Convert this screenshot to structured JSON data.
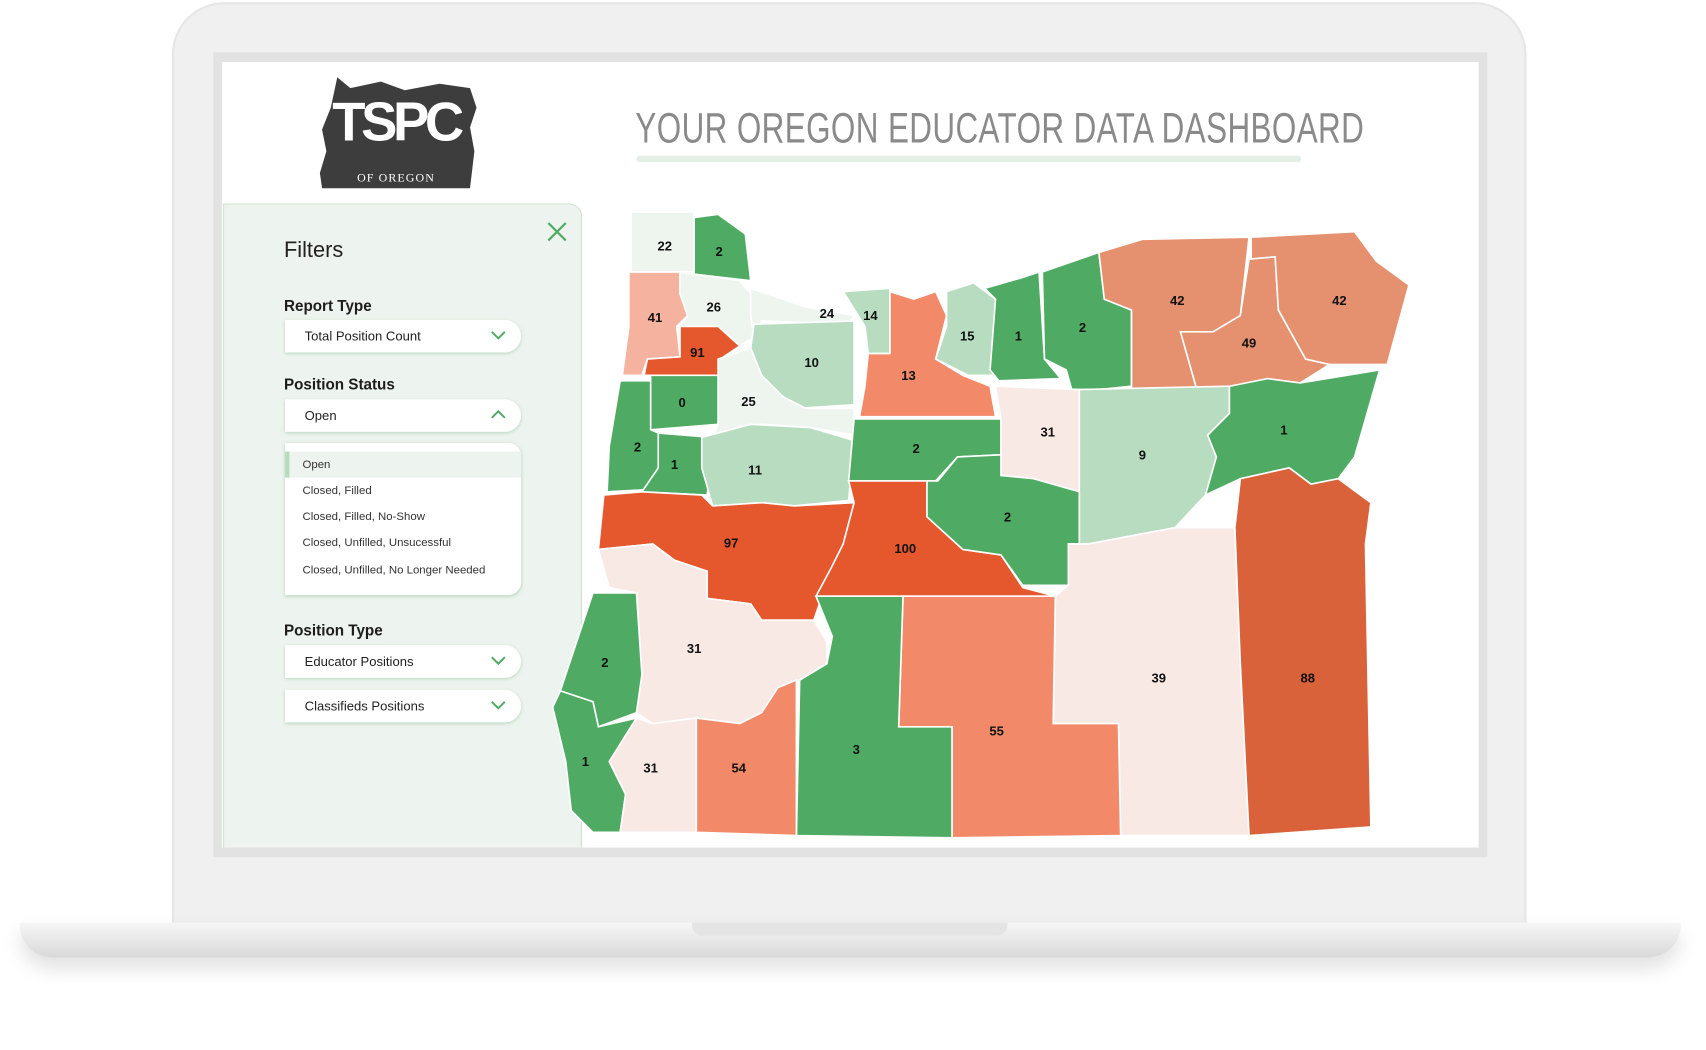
{
  "header": {
    "title": "YOUR OREGON EDUCATOR DATA DASHBOARD",
    "logo_text": "TSPC",
    "logo_subtext": "OF OREGON"
  },
  "filters": {
    "title": "Filters",
    "close_icon": "close-x-icon",
    "report_type": {
      "label": "Report Type",
      "value": "Total Position Count"
    },
    "position_status": {
      "label": "Position Status",
      "value": "Open",
      "expanded": true,
      "options": [
        "Open",
        "Closed, Filled",
        "Closed, Filled, No-Show",
        "Closed, Unfilled, Unsucessful",
        "Closed, Unfilled, No Longer Needed"
      ],
      "selected": "Open"
    },
    "position_type": {
      "label": "Position Type",
      "options": [
        "Educator Positions",
        "Classifieds Positions"
      ]
    }
  },
  "colors": {
    "accent": "#4fab63",
    "panel_bg": "#edf3ee",
    "scale": [
      "#4fab63",
      "#b8dcc0",
      "#eef5ef",
      "#f8e9e5",
      "#f4b29f",
      "#e5906f",
      "#f28a6a",
      "#d9623a",
      "#e5572d"
    ]
  },
  "map": {
    "regions": [
      {
        "value": "22",
        "color": "#eef5ef"
      },
      {
        "value": "2",
        "color": "#4fab63"
      },
      {
        "value": "41",
        "color": "#f4b29f"
      },
      {
        "value": "26",
        "color": "#eef5ef"
      },
      {
        "value": "24",
        "color": "#eef5ef"
      },
      {
        "value": "14",
        "color": "#b8dcc0"
      },
      {
        "value": "91",
        "color": "#e5572d"
      },
      {
        "value": "10",
        "color": "#b8dcc0"
      },
      {
        "value": "13",
        "color": "#f28a6a"
      },
      {
        "value": "15",
        "color": "#b8dcc0"
      },
      {
        "value": "1",
        "color": "#4fab63"
      },
      {
        "value": "2",
        "color": "#4fab63"
      },
      {
        "value": "42",
        "color": "#e5906f"
      },
      {
        "value": "49",
        "color": "#e5906f"
      },
      {
        "value": "42",
        "color": "#e5906f"
      },
      {
        "value": "0",
        "color": "#4fab63"
      },
      {
        "value": "2",
        "color": "#4fab63"
      },
      {
        "value": "25",
        "color": "#eef5ef"
      },
      {
        "value": "1",
        "color": "#4fab63"
      },
      {
        "value": "11",
        "color": "#b8dcc0"
      },
      {
        "value": "2",
        "color": "#4fab63"
      },
      {
        "value": "31",
        "color": "#f8e9e5"
      },
      {
        "value": "9",
        "color": "#b8dcc0"
      },
      {
        "value": "1",
        "color": "#4fab63"
      },
      {
        "value": "97",
        "color": "#e5572d"
      },
      {
        "value": "100",
        "color": "#e5572d"
      },
      {
        "value": "2",
        "color": "#4fab63"
      },
      {
        "value": "39",
        "color": "#f8e9e5"
      },
      {
        "value": "88",
        "color": "#d9623a"
      },
      {
        "value": "55",
        "color": "#f28a6a"
      },
      {
        "value": "3",
        "color": "#4fab63"
      },
      {
        "value": "31",
        "color": "#f8e9e5"
      },
      {
        "value": "2",
        "color": "#4fab63"
      },
      {
        "value": "1",
        "color": "#4fab63"
      },
      {
        "value": "31",
        "color": "#f8e9e5"
      },
      {
        "value": "54",
        "color": "#f28a6a"
      }
    ]
  }
}
